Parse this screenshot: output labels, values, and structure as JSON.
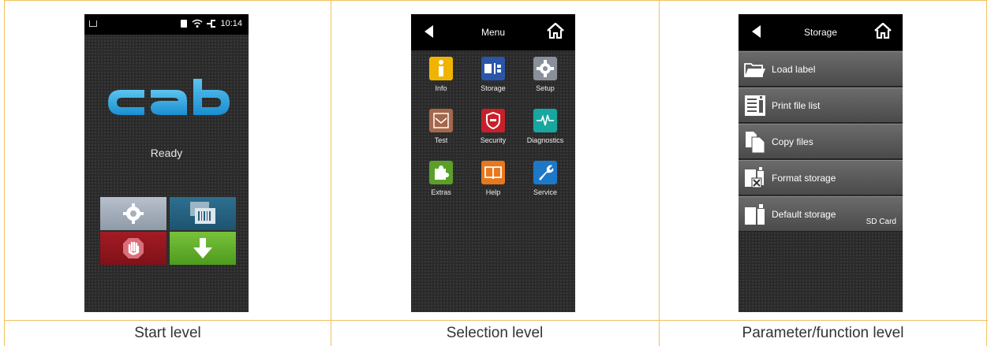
{
  "captions": [
    "Start level",
    "Selection level",
    "Parameter/function level"
  ],
  "start_screen": {
    "time": "10:14",
    "status": "Ready",
    "logo": "cab"
  },
  "menu_screen": {
    "title": "Menu",
    "items": [
      {
        "label": "Info",
        "icon": "info-icon",
        "color": "#f0b400"
      },
      {
        "label": "Storage",
        "icon": "storage-icon",
        "color": "#2a55a8"
      },
      {
        "label": "Setup",
        "icon": "gear-icon",
        "color": "#8a9099"
      },
      {
        "label": "Test",
        "icon": "test-icon",
        "color": "#a5674a"
      },
      {
        "label": "Security",
        "icon": "shield-icon",
        "color": "#c8202a"
      },
      {
        "label": "Diagnostics",
        "icon": "pulse-icon",
        "color": "#18a7a0"
      },
      {
        "label": "Extras",
        "icon": "puzzle-icon",
        "color": "#5aa028"
      },
      {
        "label": "Help",
        "icon": "book-icon",
        "color": "#e8781e"
      },
      {
        "label": "Service",
        "icon": "wrench-icon",
        "color": "#1e78c8"
      }
    ]
  },
  "storage_screen": {
    "title": "Storage",
    "items": [
      {
        "label": "Load label",
        "icon": "folder-open-icon",
        "value": ""
      },
      {
        "label": "Print file list",
        "icon": "file-list-icon",
        "value": ""
      },
      {
        "label": "Copy files",
        "icon": "copy-files-icon",
        "value": ""
      },
      {
        "label": "Format storage",
        "icon": "format-storage-icon",
        "value": ""
      },
      {
        "label": "Default storage",
        "icon": "default-storage-icon",
        "value": "SD Card"
      }
    ]
  }
}
